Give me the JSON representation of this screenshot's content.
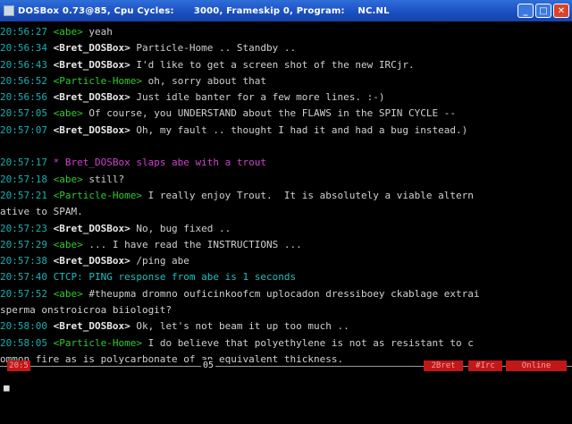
{
  "window": {
    "title": "DOSBox 0.73@85, Cpu Cycles:      3000, Frameskip 0, Program:    NC.NL",
    "minimize": "_",
    "maximize": "□",
    "close": "✕"
  },
  "lines": [
    {
      "ts": "20:56:27",
      "nick": "<abe>",
      "nc": "g",
      "msg": " yeah"
    },
    {
      "ts": "20:56:34",
      "nick": "<Bret_DOSBox>",
      "nc": "w",
      "msg": " Particle-Home .. Standby .."
    },
    {
      "ts": "20:56:43",
      "nick": "<Bret_DOSBox>",
      "nc": "w",
      "msg": " I'd like to get a screen shot of the new IRCjr."
    },
    {
      "ts": "20:56:52",
      "nick": "<Particle-Home>",
      "nc": "g",
      "msg": " oh, sorry about that"
    },
    {
      "ts": "20:56:56",
      "nick": "<Bret_DOSBox>",
      "nc": "w",
      "msg": " Just idle banter for a few more lines. :-)"
    },
    {
      "ts": "20:57:05",
      "nick": "<abe>",
      "nc": "g",
      "msg": " Of course, you UNDERSTAND about the FLAWS in the SPIN CYCLE --"
    },
    {
      "ts": "20:57:07",
      "nick": "<Bret_DOSBox>",
      "nc": "w",
      "msg": " Oh, my fault .. thought I had it and had a bug instead.)"
    },
    {
      "ts": "",
      "nick": "",
      "nc": "",
      "msg": ""
    },
    {
      "ts": "20:57:17",
      "nick": "",
      "nc": "",
      "msg": "",
      "act": " * Bret_DOSBox slaps abe with a trout"
    },
    {
      "ts": "20:57:18",
      "nick": "<abe>",
      "nc": "g",
      "msg": " still?"
    },
    {
      "ts": "20:57:21",
      "nick": "<Particle-Home>",
      "nc": "g",
      "msg": " I really enjoy Trout.  It is absolutely a viable altern"
    },
    {
      "ts": "",
      "nick": "",
      "nc": "",
      "msg": "ative to SPAM."
    },
    {
      "ts": "20:57:23",
      "nick": "<Bret_DOSBox>",
      "nc": "w",
      "msg": " No, bug fixed .."
    },
    {
      "ts": "20:57:29",
      "nick": "<abe>",
      "nc": "g",
      "msg": " ... I have read the INSTRUCTIONS ..."
    },
    {
      "ts": "20:57:38",
      "nick": "<Bret_DOSBox>",
      "nc": "w",
      "msg": " /ping abe"
    },
    {
      "ts": "20:57:40",
      "nick": "",
      "nc": "",
      "msg": "",
      "ctcp": " CTCP: PING response from abe is 1 seconds"
    },
    {
      "ts": "20:57:52",
      "nick": "<abe>",
      "nc": "g",
      "msg": " #theupma dromno ouficinkoofcm uplocadon dressiboey ckablage extrai"
    },
    {
      "ts": "",
      "nick": "",
      "nc": "",
      "msg": "sperma onstroicroa biiologit?"
    },
    {
      "ts": "20:58:00",
      "nick": "<Bret_DOSBox>",
      "nc": "w",
      "msg": " Ok, let's not beam it up too much .."
    },
    {
      "ts": "20:58:05",
      "nick": "<Particle-Home>",
      "nc": "g",
      "msg": " I do believe that polyethylene is not as resistant to c"
    },
    {
      "ts": "",
      "nick": "",
      "nc": "",
      "msg": "ommon fire as is polycarbonate of an equivalent thickness."
    }
  ],
  "status": {
    "left": "20:5",
    "middle": "05",
    "right1": "2Bret",
    "right2": "#Irc",
    "right3": "Online"
  },
  "input": {
    "value": "■"
  }
}
